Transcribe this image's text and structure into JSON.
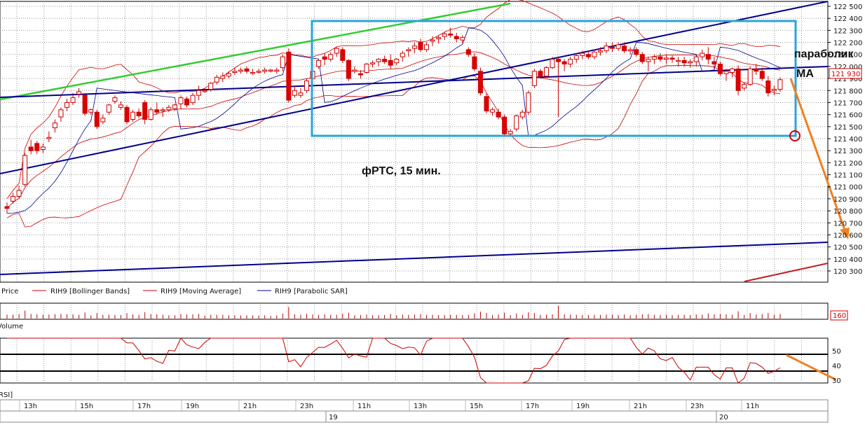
{
  "chart_data": {
    "type": "candlestick",
    "title": "фРТС,  15 мин.",
    "annotations": {
      "parabolic": "параболик",
      "ma": "МА"
    },
    "price_axis": {
      "ticks": [
        122500,
        122400,
        122300,
        122200,
        122100,
        122000,
        121900,
        121800,
        121700,
        121600,
        121500,
        121400,
        121300,
        121200,
        121100,
        121000,
        120900,
        120800,
        120700,
        120600,
        120500,
        120400,
        120300
      ],
      "tick_labels": [
        "122 500",
        "122 400",
        "122 300",
        "122 200",
        "122 100",
        "122 000",
        "121 900",
        "121 800",
        "121 700",
        "121 600",
        "121 500",
        "121 400",
        "121 300",
        "121 200",
        "121 100",
        "121 000",
        "120 900",
        "120 800",
        "120 700",
        "120 600",
        "120 500",
        "120 400",
        "120 300"
      ],
      "range": [
        120200,
        122540
      ],
      "last_price": 121930,
      "last_price_label": "121 930"
    },
    "legend": [
      {
        "name": "Price",
        "color": "#cc0000"
      },
      {
        "name": "RIH9 [Bollinger Bands]",
        "color": "#cc0000"
      },
      {
        "name": "RIH9 [Moving Average]",
        "color": "#cc0000"
      },
      {
        "name": "RIH9 [Parabolic SAR]",
        "color": "#00008b"
      }
    ],
    "volume": {
      "label": "Volume",
      "last_value": "160"
    },
    "rsi": {
      "label": "RSI]",
      "ticks": [
        "50",
        "40",
        "30"
      ],
      "levels": [
        50,
        35
      ],
      "range": [
        28,
        62
      ]
    },
    "time_axis": {
      "labels": [
        "13h",
        "15h",
        "17h",
        "19h",
        "21h",
        "23h",
        "11h",
        "13h",
        "15h",
        "17h",
        "19h",
        "21h",
        "23h",
        "11h"
      ],
      "days": [
        "19",
        "20"
      ]
    },
    "candles": [
      [
        120835,
        120870,
        120780,
        120820
      ],
      [
        120880,
        120950,
        120860,
        120920
      ],
      [
        120920,
        121010,
        120900,
        120970
      ],
      [
        121020,
        121280,
        121000,
        121260
      ],
      [
        121330,
        121390,
        121270,
        121300
      ],
      [
        121360,
        121380,
        121270,
        121300
      ],
      [
        121310,
        121360,
        121280,
        121330
      ],
      [
        121400,
        121460,
        121370,
        121410
      ],
      [
        121490,
        121560,
        121450,
        121530
      ],
      [
        121580,
        121660,
        121540,
        121640
      ],
      [
        121660,
        121730,
        121630,
        121700
      ],
      [
        121700,
        121780,
        121680,
        121740
      ],
      [
        121770,
        121820,
        121740,
        121790
      ],
      [
        121760,
        121780,
        121590,
        121610
      ],
      [
        121620,
        121650,
        121600,
        121640
      ],
      [
        121620,
        121640,
        121480,
        121500
      ],
      [
        121540,
        121600,
        121520,
        121570
      ],
      [
        121620,
        121690,
        121600,
        121680
      ],
      [
        121710,
        121760,
        121690,
        121740
      ],
      [
        121660,
        121710,
        121640,
        121680
      ],
      [
        121660,
        121680,
        121520,
        121540
      ],
      [
        121560,
        121640,
        121540,
        121620
      ],
      [
        121620,
        121650,
        121570,
        121590
      ],
      [
        121700,
        121720,
        121520,
        121560
      ],
      [
        121560,
        121660,
        121550,
        121640
      ],
      [
        121640,
        121700,
        121600,
        121620
      ],
      [
        121640,
        121660,
        121580,
        121640
      ],
      [
        121640,
        121680,
        121620,
        121660
      ],
      [
        121650,
        121690,
        121630,
        121680
      ],
      [
        121690,
        121760,
        121650,
        121740
      ],
      [
        121730,
        121750,
        121660,
        121680
      ],
      [
        121700,
        121780,
        121680,
        121760
      ],
      [
        121760,
        121840,
        121720,
        121800
      ],
      [
        121800,
        121820,
        121780,
        121800
      ],
      [
        121810,
        121870,
        121790,
        121860
      ],
      [
        121870,
        121930,
        121850,
        121910
      ],
      [
        121900,
        121950,
        121870,
        121920
      ],
      [
        121920,
        121960,
        121900,
        121940
      ],
      [
        121950,
        121990,
        121930,
        121960
      ],
      [
        121960,
        121990,
        121940,
        121970
      ],
      [
        121980,
        122000,
        121940,
        121960
      ],
      [
        121950,
        121980,
        121930,
        121950
      ],
      [
        121960,
        121980,
        121940,
        121960
      ],
      [
        121960,
        121990,
        121940,
        121970
      ],
      [
        121970,
        121980,
        121950,
        121970
      ],
      [
        121960,
        121990,
        121940,
        121970
      ],
      [
        121990,
        122100,
        121960,
        122080
      ],
      [
        122120,
        122150,
        121700,
        121720
      ],
      [
        121760,
        121840,
        121740,
        121800
      ],
      [
        121760,
        121820,
        121740,
        121780
      ],
      [
        121800,
        121900,
        121780,
        121880
      ],
      [
        121900,
        121980,
        121880,
        121960
      ],
      [
        122000,
        122060,
        121980,
        122050
      ],
      [
        122080,
        122110,
        122010,
        122060
      ],
      [
        122060,
        122120,
        122040,
        122100
      ],
      [
        122110,
        122160,
        122080,
        122150
      ],
      [
        122140,
        122160,
        122030,
        122050
      ],
      [
        122050,
        122060,
        121880,
        121900
      ],
      [
        121960,
        122000,
        121940,
        121970
      ],
      [
        121940,
        121970,
        121900,
        121930
      ],
      [
        121950,
        122030,
        121940,
        122020
      ],
      [
        122020,
        122050,
        121990,
        122030
      ],
      [
        122040,
        122070,
        122000,
        122060
      ],
      [
        122060,
        122090,
        122020,
        122040
      ],
      [
        122050,
        122100,
        121980,
        122010
      ],
      [
        122030,
        122070,
        122010,
        122060
      ],
      [
        122080,
        122130,
        122040,
        122110
      ],
      [
        122130,
        122160,
        122080,
        122140
      ],
      [
        122150,
        122200,
        122110,
        122170
      ],
      [
        122200,
        122230,
        122120,
        122140
      ],
      [
        122140,
        122200,
        122120,
        122180
      ],
      [
        122210,
        122250,
        122170,
        122220
      ],
      [
        122230,
        122260,
        122190,
        122240
      ],
      [
        122250,
        122290,
        122220,
        122270
      ],
      [
        122270,
        122320,
        122240,
        122260
      ],
      [
        122250,
        122280,
        122200,
        122230
      ],
      [
        122220,
        122260,
        122190,
        122240
      ],
      [
        122140,
        122160,
        122080,
        122100
      ],
      [
        122080,
        122110,
        121960,
        121980
      ],
      [
        121960,
        121990,
        121760,
        121780
      ],
      [
        121750,
        121780,
        121610,
        121630
      ],
      [
        121620,
        121660,
        121590,
        121640
      ],
      [
        121620,
        121650,
        121560,
        121580
      ],
      [
        121580,
        121600,
        121420,
        121440
      ],
      [
        121440,
        121480,
        121420,
        121460
      ],
      [
        121480,
        121600,
        121460,
        121590
      ],
      [
        121580,
        121640,
        121560,
        121620
      ],
      [
        121620,
        121800,
        121600,
        121780
      ],
      [
        121840,
        121980,
        121820,
        121960
      ],
      [
        121960,
        121980,
        121900,
        121920
      ],
      [
        121920,
        122000,
        121910,
        121990
      ],
      [
        121990,
        122080,
        121980,
        122060
      ],
      [
        122060,
        122080,
        121580,
        122040
      ],
      [
        122040,
        122060,
        121960,
        122020
      ],
      [
        122020,
        122080,
        121990,
        122060
      ],
      [
        122060,
        122110,
        122030,
        122090
      ],
      [
        122090,
        122130,
        122060,
        122110
      ],
      [
        122100,
        122130,
        122060,
        122080
      ],
      [
        122080,
        122140,
        122060,
        122120
      ],
      [
        122120,
        122160,
        122090,
        122130
      ],
      [
        122130,
        122200,
        122110,
        122170
      ],
      [
        122160,
        122200,
        122120,
        122150
      ],
      [
        122150,
        122200,
        122130,
        122180
      ],
      [
        122170,
        122200,
        122110,
        122130
      ],
      [
        122130,
        122160,
        122100,
        122140
      ],
      [
        122140,
        122160,
        122080,
        122100
      ],
      [
        122100,
        122120,
        122020,
        122040
      ],
      [
        122040,
        122080,
        121960,
        122060
      ],
      [
        122060,
        122100,
        122020,
        122080
      ],
      [
        122080,
        122110,
        122040,
        122060
      ],
      [
        122060,
        122100,
        122020,
        122070
      ],
      [
        122070,
        122090,
        122030,
        122060
      ],
      [
        122050,
        122080,
        122000,
        122050
      ],
      [
        122050,
        122080,
        122000,
        122030
      ],
      [
        122030,
        122060,
        121990,
        122040
      ],
      [
        122040,
        122100,
        122000,
        122080
      ],
      [
        122080,
        122140,
        122050,
        122110
      ],
      [
        122100,
        122160,
        122020,
        122060
      ],
      [
        122040,
        122080,
        121980,
        122020
      ],
      [
        122020,
        122040,
        121920,
        121940
      ],
      [
        121940,
        121980,
        121880,
        121960
      ],
      [
        121950,
        121990,
        121910,
        121980
      ],
      [
        121980,
        122010,
        121760,
        121800
      ],
      [
        121820,
        121870,
        121800,
        121850
      ],
      [
        121850,
        122000,
        121840,
        121980
      ],
      [
        121980,
        122020,
        121930,
        121960
      ],
      [
        121960,
        121990,
        121880,
        121900
      ],
      [
        121880,
        121920,
        121750,
        121780
      ],
      [
        121800,
        121840,
        121760,
        121810
      ],
      [
        121810,
        121910,
        121790,
        121890
      ]
    ],
    "lines_note": "Bollinger bands, moving average, parabolic SAR, hand-drawn trendlines and forecast arrows are rendered as overlay shapes"
  }
}
